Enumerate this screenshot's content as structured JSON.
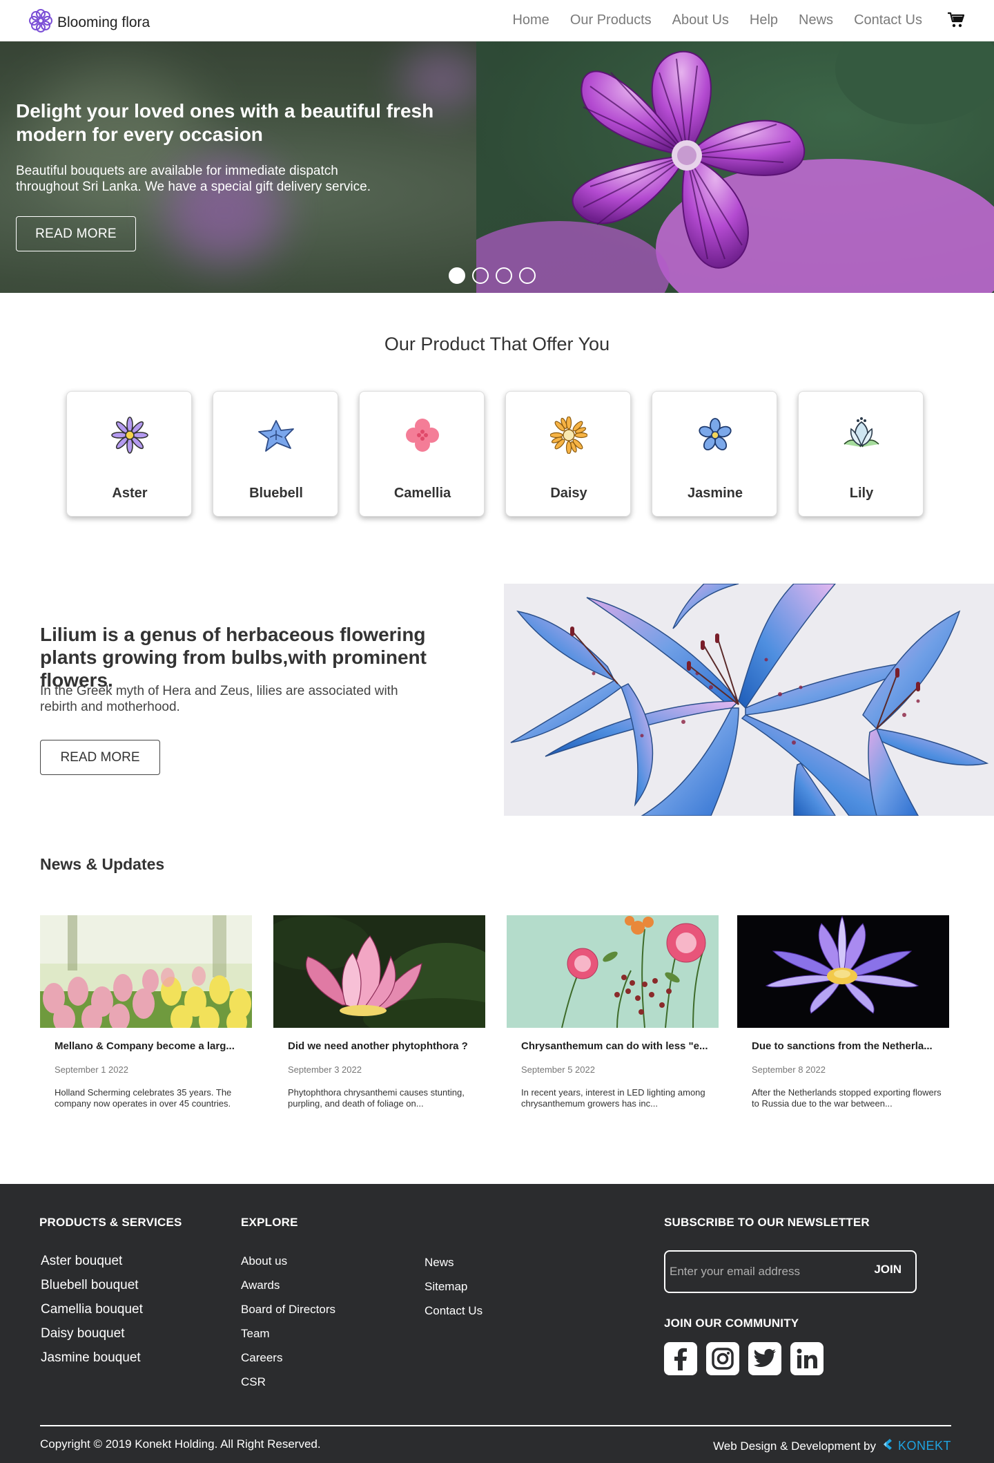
{
  "nav": {
    "brand": "Blooming flora",
    "items": [
      "Home",
      "Our Products",
      "About Us",
      "Help",
      "News",
      "Contact Us"
    ]
  },
  "hero": {
    "title": "Delight your loved ones with a beautiful fresh modern   for every occasion",
    "text": "Beautiful bouquets are available for immediate dispatch throughout Sri Lanka. We have a special gift delivery service.",
    "button": "READ MORE",
    "slides": 4,
    "active_slide": 1
  },
  "products": {
    "title": "Our Product That Offer You",
    "items": [
      {
        "label": "Aster",
        "icon": "aster-icon"
      },
      {
        "label": "Bluebell",
        "icon": "bluebell-icon"
      },
      {
        "label": "Camellia",
        "icon": "camellia-icon"
      },
      {
        "label": "Daisy",
        "icon": "daisy-icon"
      },
      {
        "label": "Jasmine",
        "icon": "jasmine-icon"
      },
      {
        "label": "Lily",
        "icon": "lily-icon"
      }
    ]
  },
  "lily": {
    "title": "Lilium is a genus of herbaceous flowering plants growing from bulbs,with prominent flowers.",
    "text": "In the Greek myth of Hera and Zeus, lilies are associated with rebirth and motherhood.",
    "button": "READ MORE"
  },
  "news": {
    "title": "News & Updates",
    "items": [
      {
        "title": "Mellano & Company become a larg...",
        "date": "September 1 2022",
        "text": "Holland Scherming celebrates 35 years. The company now operates in over 45 countries."
      },
      {
        "title": "Did we need another phytophthora ?",
        "date": "September 3 2022",
        "text": "Phytophthora chrysanthemi causes stunting, purpling, and death of foliage on..."
      },
      {
        "title": "Chrysanthemum can do with less \"e...",
        "date": "September 5 2022",
        "text": "In recent years, interest in LED lighting among chrysanthemum growers has inc..."
      },
      {
        "title": "Due to sanctions from the Netherla...",
        "date": "September 8 2022",
        "text": "After the Netherlands stopped exporting flowers to Russia due to the war between..."
      }
    ]
  },
  "footer": {
    "products_heading": "PRODUCTS & SERVICES",
    "products": [
      "Aster bouquet",
      "Bluebell bouquet",
      "Camellia bouquet",
      "Daisy bouquet",
      "Jasmine bouquet"
    ],
    "explore_heading": "EXPLORE",
    "explore": [
      "About us",
      "Awards",
      "Board of Directors",
      "Team",
      "Careers",
      "CSR"
    ],
    "explore2": [
      "News",
      "Sitemap",
      "Contact Us"
    ],
    "newsletter_heading": "SUBSCRIBE TO OUR NEWSLETTER",
    "email_placeholder": "Enter your email address",
    "join": "JOIN",
    "community_heading": "JOIN OUR COMMUNITY",
    "socials": [
      "facebook-icon",
      "instagram-icon",
      "twitter-icon",
      "linkedin-icon"
    ],
    "copyright": "Copyright © 2019 Konekt Holding. All Right Reserved.",
    "credit": "Web Design & Development by",
    "credit_brand": "KONEKT"
  }
}
